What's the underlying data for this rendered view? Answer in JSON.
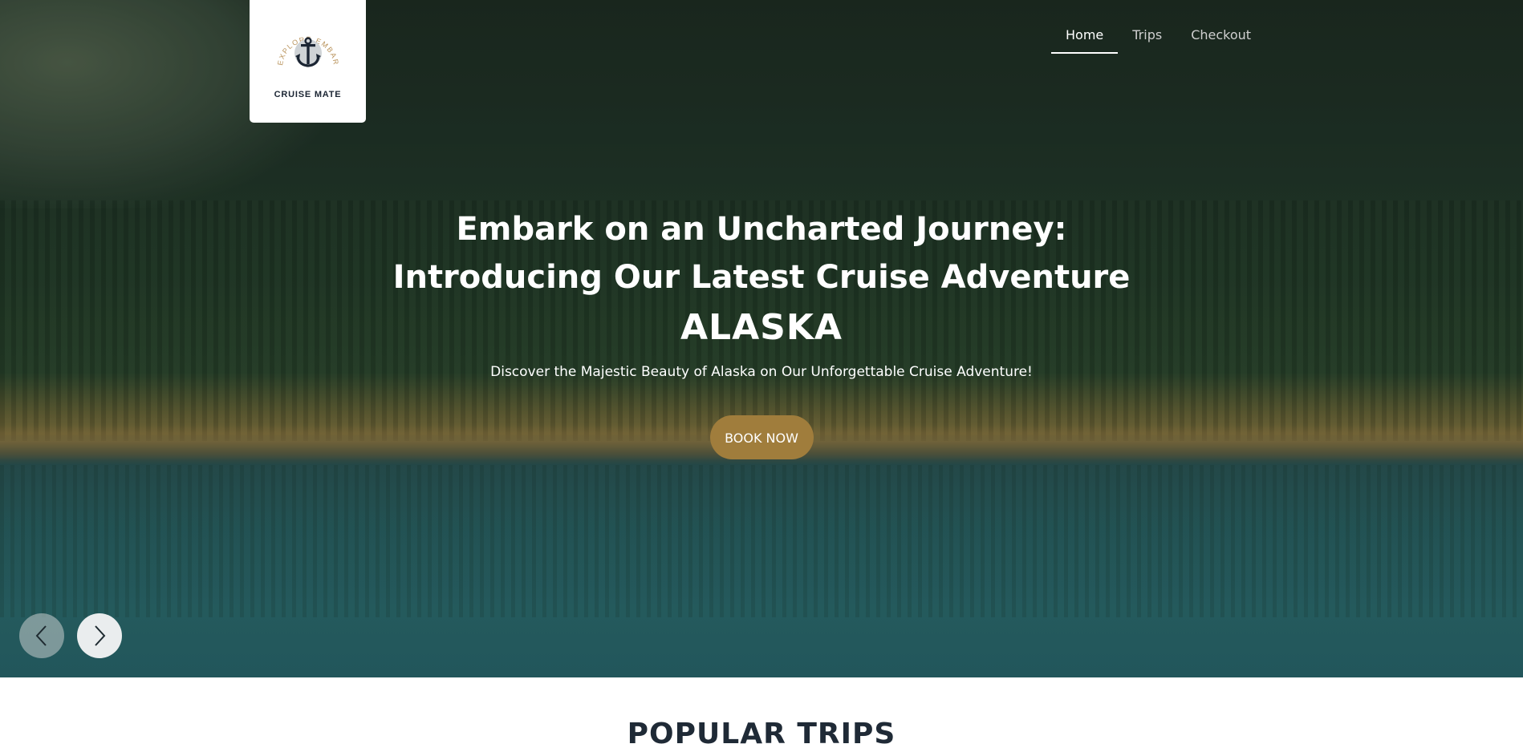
{
  "brand": {
    "name": "CRUISE MATE",
    "emblem_text": "EXPLORE.EMBARK.ENJOY!",
    "emblem_icon": "anchor-icon"
  },
  "nav": {
    "items": [
      {
        "label": "Home",
        "active": true
      },
      {
        "label": "Trips",
        "active": false
      },
      {
        "label": "Checkout",
        "active": false
      }
    ]
  },
  "hero": {
    "title_line1": "Embark on an Uncharted Journey:",
    "title_line2": "Introducing Our Latest Cruise Adventure",
    "destination": "ALASKA",
    "subtitle": "Discover the Majestic Beauty of Alaska on Our Unforgettable Cruise Adventure!",
    "cta_label": "BOOK NOW",
    "cta_color": "#a07d3c"
  },
  "carousel": {
    "prev_icon": "chevron-left-icon",
    "next_icon": "chevron-right-icon"
  },
  "sections": {
    "popular_title": "POPULAR TRIPS"
  }
}
